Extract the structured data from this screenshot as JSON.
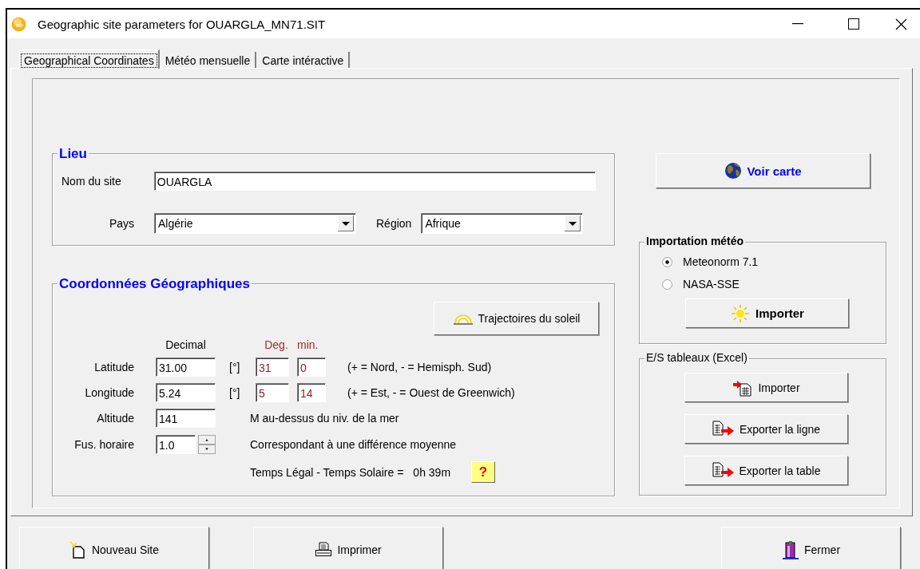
{
  "window": {
    "title": "Geographic site parameters for OUARGLA_MN71.SIT"
  },
  "tabs": [
    {
      "label": "Geographical Coordinates",
      "selected": true
    },
    {
      "label": "Météo mensuelle",
      "selected": false
    },
    {
      "label": "Carte intéractive",
      "selected": false
    }
  ],
  "lieu": {
    "legend": "Lieu",
    "site_name": {
      "label": "Nom du site",
      "value": "OUARGLA"
    },
    "country": {
      "label": "Pays",
      "value": "Algérie"
    },
    "region": {
      "label": "Région",
      "value": "Afrique"
    }
  },
  "coordinates": {
    "legend": "Coordonnées Géographiques",
    "sun_paths_button": "Trajectoires du soleil",
    "headers": {
      "decimal": "Decimal",
      "deg": "Deg.",
      "min": "min."
    },
    "rows": [
      {
        "kind": "dms",
        "label": "Latitude",
        "decimal": "31.00",
        "unit": "[°]",
        "deg": "31",
        "min": "0",
        "note": "(+ = Nord,  - = Hemisph. Sud)"
      },
      {
        "kind": "dms",
        "label": "Longitude",
        "decimal": "5.24",
        "unit": "[°]",
        "deg": "5",
        "min": "14",
        "note": "(+ = Est, - = Ouest de Greenwich)"
      },
      {
        "kind": "plain",
        "label": "Altitude",
        "value": "141",
        "note": "M au-dessus du niv. de la mer"
      },
      {
        "kind": "spin",
        "label": "Fus. horaire",
        "value": "1.0",
        "note": "Correspondant à une différence moyenne"
      }
    ],
    "solar_time": {
      "label": "Temps Légal - Temps Solaire =",
      "value": "0h 39m",
      "help_button": "?"
    }
  },
  "map_button": "Voir carte",
  "meteo_import": {
    "legend": "Importation météo",
    "options": [
      {
        "label": "Meteonorm 7.1",
        "selected": true
      },
      {
        "label": "NASA-SSE",
        "selected": false
      }
    ],
    "button": "Importer"
  },
  "excel": {
    "legend": "E/S tableaux (Excel)",
    "buttons": [
      {
        "label": "Importer",
        "kind": "import"
      },
      {
        "label": "Exporter la ligne",
        "kind": "export"
      },
      {
        "label": "Exporter la table",
        "kind": "export"
      }
    ]
  },
  "footer_buttons": [
    {
      "label": "Nouveau Site",
      "kind": "new"
    },
    {
      "label": "Imprimer",
      "kind": "print"
    },
    {
      "label": "Fermer",
      "kind": "close"
    }
  ]
}
